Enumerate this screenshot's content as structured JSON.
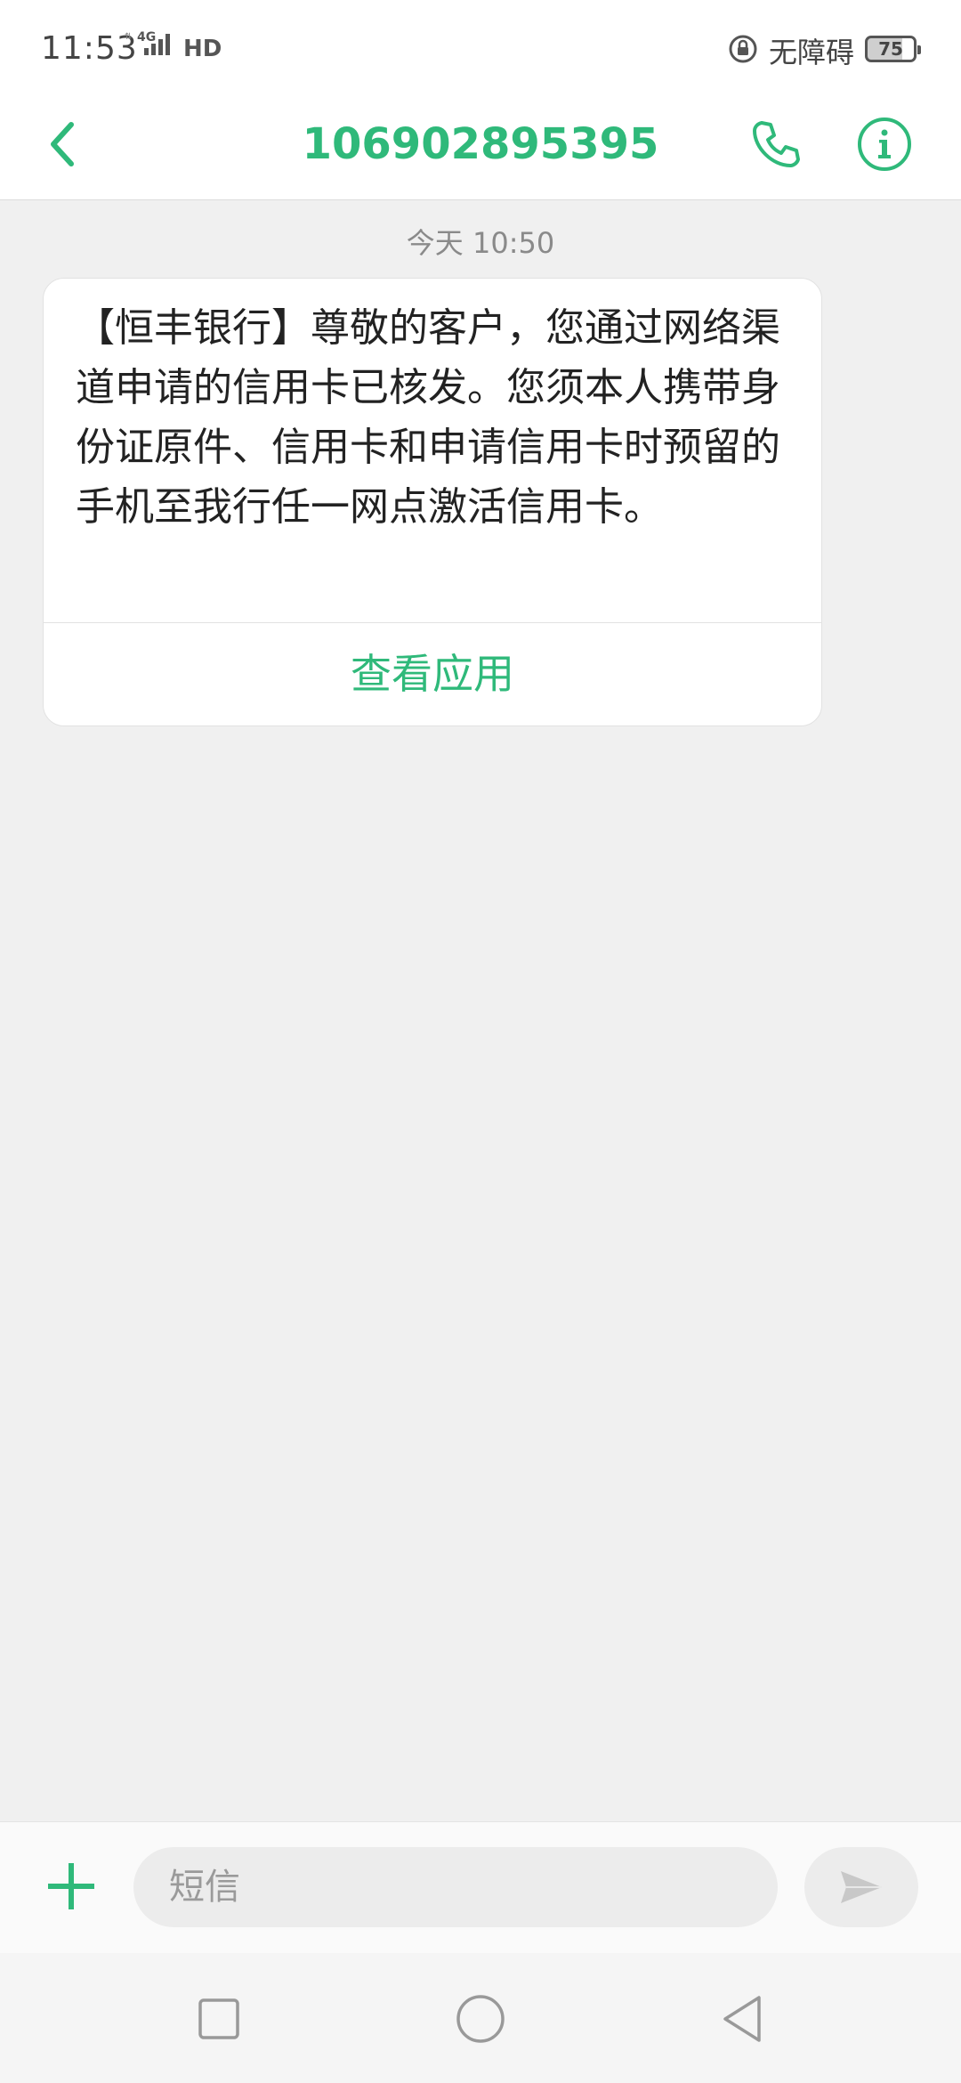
{
  "status_bar": {
    "time": "11:53",
    "network": "4G",
    "hd": "HD",
    "accessibility_label": "无障碍",
    "battery": "75",
    "battery_level": 0.75,
    "icons": [
      "signal-icon",
      "lock-rotation-icon",
      "battery-icon"
    ]
  },
  "header": {
    "title": "106902895395",
    "icons": [
      "back-arrow-icon",
      "phone-icon",
      "info-icon"
    ],
    "accent_color": "#2fb97a"
  },
  "conversation": {
    "timestamp": "今天 10:50",
    "messages": [
      {
        "text": "【恒丰银行】尊敬的客户，您通过网络渠道申请的信用卡已核发。您须本人携带身份证原件、信用卡和申请信用卡时预留的手机至我行任一网点激活信用卡。",
        "action_label": "查看应用"
      }
    ]
  },
  "composer": {
    "placeholder": "短信",
    "value": "",
    "icons": [
      "plus-icon",
      "send-icon"
    ]
  },
  "nav_bar": {
    "icons": [
      "recent-apps-icon",
      "home-icon",
      "back-icon"
    ]
  }
}
